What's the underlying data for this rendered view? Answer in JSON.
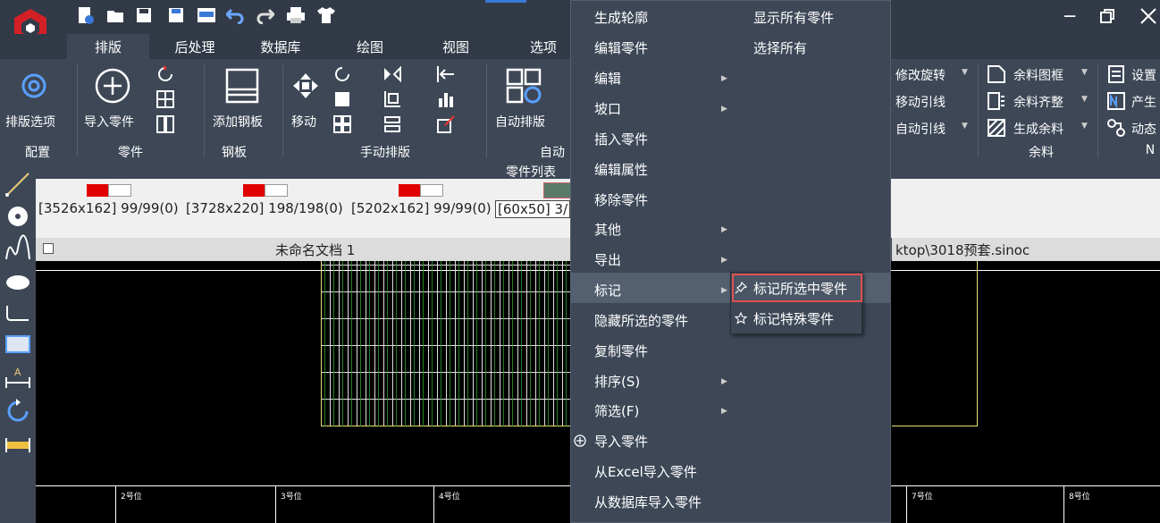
{
  "tabs": [
    "排版",
    "后处理",
    "数据库",
    "绘图",
    "视图",
    "选项"
  ],
  "ribbon": {
    "nest_options": "排版选项",
    "import_parts": "导入零件",
    "add_sheet": "添加钢板",
    "move": "移动",
    "auto_nest": "自动排版",
    "modify_rotate": "修改旋转",
    "move_leader": "移动引线",
    "auto_leader": "自动引线",
    "remnant_frame": "余料图框",
    "remnant_align": "余料齐整",
    "gen_remnant": "生成余料",
    "settings": "设置",
    "produce": "产生",
    "dynamic": "动态",
    "groups": {
      "config": "配置",
      "parts": "零件",
      "sheet": "钢板",
      "manual": "手动排版",
      "auto": "自动",
      "remnant": "余料",
      "n": "N"
    }
  },
  "parts_list_title": "零件列表",
  "parts": [
    "[3526x162] 99/99(0)",
    "[3728x220] 198/198(0)",
    "[5202x162] 99/99(0)",
    "[60x50] 3/"
  ],
  "doc": {
    "title": "未命名文档 1",
    "path": "ktop\\3018预套.sinoc"
  },
  "positions": [
    "2号位",
    "3号位",
    "4号位",
    "7号位",
    "8号位"
  ],
  "context_menu": {
    "items": [
      "生成轮廓",
      "编辑零件",
      "编辑",
      "坡口",
      "插入零件",
      "编辑属性",
      "移除零件",
      "其他",
      "导出",
      "标记",
      "隐藏所选的零件",
      "复制零件",
      "排序(S)",
      "筛选(F)",
      "导入零件",
      "从Excel导入零件",
      "从数据库导入零件"
    ],
    "col2": [
      "显示所有零件",
      "选择所有"
    ]
  },
  "submenu": {
    "items": [
      "标记所选中零件",
      "标记特殊零件"
    ]
  }
}
